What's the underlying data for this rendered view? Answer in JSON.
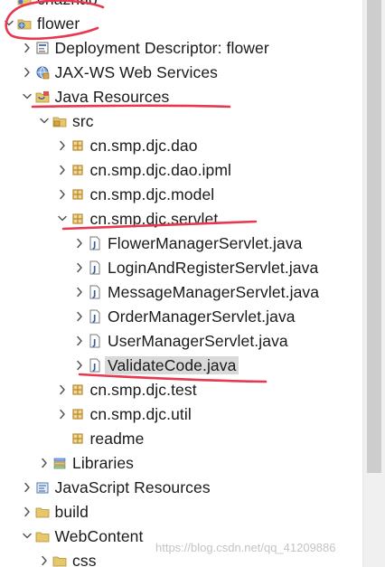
{
  "tree": {
    "rows": [
      {
        "label": "chazhao",
        "icon": "project-icon",
        "arrow": "",
        "depth": 0
      },
      {
        "label": "flower",
        "icon": "web-project-icon",
        "arrow": "expanded",
        "depth": 0
      },
      {
        "label": "Deployment Descriptor: flower",
        "icon": "deployment-descriptor-icon",
        "arrow": "collapsed",
        "depth": 1
      },
      {
        "label": "JAX-WS Web Services",
        "icon": "web-services-icon",
        "arrow": "collapsed",
        "depth": 1
      },
      {
        "label": "Java Resources",
        "icon": "java-resources-icon",
        "arrow": "expanded",
        "depth": 1
      },
      {
        "label": "src",
        "icon": "source-folder-icon",
        "arrow": "expanded",
        "depth": 2
      },
      {
        "label": "cn.smp.djc.dao",
        "icon": "package-icon",
        "arrow": "collapsed",
        "depth": 3
      },
      {
        "label": "cn.smp.djc.dao.ipml",
        "icon": "package-icon",
        "arrow": "collapsed",
        "depth": 3
      },
      {
        "label": "cn.smp.djc.model",
        "icon": "package-icon",
        "arrow": "collapsed",
        "depth": 3
      },
      {
        "label": "cn.smp.djc.servlet",
        "icon": "package-icon",
        "arrow": "expanded",
        "depth": 3
      },
      {
        "label": "FlowerManagerServlet.java",
        "icon": "java-file-icon",
        "arrow": "collapsed",
        "depth": 4
      },
      {
        "label": "LoginAndRegisterServlet.java",
        "icon": "java-file-icon",
        "arrow": "collapsed",
        "depth": 4
      },
      {
        "label": "MessageManagerServlet.java",
        "icon": "java-file-icon",
        "arrow": "collapsed",
        "depth": 4
      },
      {
        "label": "OrderManagerServlet.java",
        "icon": "java-file-icon",
        "arrow": "collapsed",
        "depth": 4
      },
      {
        "label": "UserManagerServlet.java",
        "icon": "java-file-icon",
        "arrow": "collapsed",
        "depth": 4
      },
      {
        "label": "ValidateCode.java",
        "icon": "java-file-icon",
        "arrow": "collapsed",
        "depth": 4,
        "selected": true
      },
      {
        "label": "cn.smp.djc.test",
        "icon": "package-icon",
        "arrow": "collapsed",
        "depth": 3
      },
      {
        "label": "cn.smp.djc.util",
        "icon": "package-icon",
        "arrow": "collapsed",
        "depth": 3
      },
      {
        "label": "readme",
        "icon": "package-icon",
        "arrow": "",
        "depth": 3
      },
      {
        "label": "Libraries",
        "icon": "libraries-icon",
        "arrow": "collapsed",
        "depth": 2
      },
      {
        "label": "JavaScript Resources",
        "icon": "javascript-resources-icon",
        "arrow": "collapsed",
        "depth": 1
      },
      {
        "label": "build",
        "icon": "folder-icon",
        "arrow": "collapsed",
        "depth": 1
      },
      {
        "label": "WebContent",
        "icon": "folder-icon",
        "arrow": "expanded",
        "depth": 1
      },
      {
        "label": "css",
        "icon": "folder-icon",
        "arrow": "collapsed",
        "depth": 2
      }
    ]
  },
  "watermark": "https://blog.csdn.net/qq_41209886",
  "colors": {
    "annotation": "#e8384f",
    "folder": "#e7c76d",
    "package": "#b8892b",
    "java_blue": "#2e5aa8",
    "arrow": "#555555",
    "selected_bg": "#d9d9d9"
  }
}
